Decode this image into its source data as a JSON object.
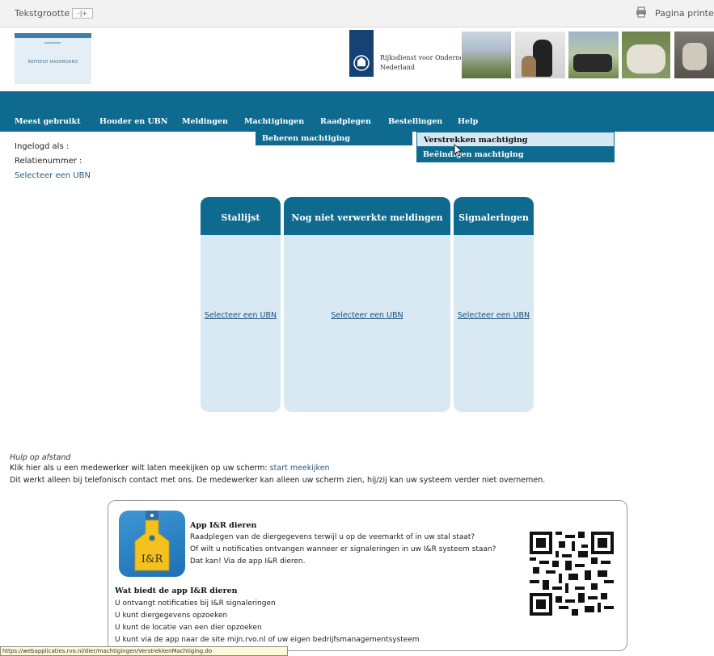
{
  "toolbar": {
    "text_size_label": "Tekstgrootte",
    "font_size_buttons": "-|+",
    "print_label": "Pagina printen",
    "print_icon": "printer-icon"
  },
  "header": {
    "refresh_tile_text": "REFRESH DASHBOARD",
    "org_name_line1": "Rijksdienst voor Ondernemend",
    "org_name_line2": "Nederland",
    "logo": "rijksoverheid-logo"
  },
  "nav": {
    "items": [
      "Meest gebruikt",
      "Houder en UBN",
      "Meldingen",
      "Machtigingen",
      "Raadplegen",
      "Bestellingen",
      "Help"
    ],
    "active_item": "Machtigingen",
    "color": "#0e6b8f"
  },
  "submenu": {
    "beheren": "Beheren machtiging",
    "verstrekken": "Verstrekken machtiging",
    "beeindigen": "Beëindigen machtiging"
  },
  "user": {
    "logged_in_label": "Ingelogd als :",
    "relation_label": "Relatienummer :",
    "select_ubn": "Selecteer een UBN"
  },
  "panels": [
    {
      "title": "Stallijst",
      "link": "Selecteer een UBN"
    },
    {
      "title": "Nog niet verwerkte meldingen",
      "link": "Selecteer een UBN"
    },
    {
      "title": "Signaleringen",
      "link": "Selecteer een UBN"
    }
  ],
  "help": {
    "title": "Hulp op afstand",
    "line1_prefix": "Klik hier als u een medewerker wilt laten meekijken op uw scherm:",
    "line1_link": "start meekijken",
    "line2": "Dit werkt alleen bij telefonisch contact met ons. De medewerker kan alleen uw scherm zien, hij/zij kan uw systeem verder niet overnemen."
  },
  "app": {
    "title": "App I&R dieren",
    "icon_label": "I&R",
    "lines": [
      "Raadplegen van de diergegevens terwijl u op de veemarkt of in uw stal staat?",
      "Of wilt u notificaties ontvangen wanneer er signaleringen in uw I&R systeem staan?",
      "Dat kan! Via de app I&R dieren."
    ],
    "benefits_title": "Wat biedt de app I&R dieren",
    "benefits": [
      "U ontvangt notificaties bij I&R signaleringen",
      "U kunt diergegevens opzoeken",
      "U kunt de locatie van een dier opzoeken",
      "U kunt via de app naar de site mijn.rvo.nl of uw eigen bedrijfsmanagementsysteem"
    ]
  },
  "statusbar": {
    "url": "https://webapplicaties.rvo.nl/dier/machtigingen/VerstrekkenMachtiging.do"
  }
}
